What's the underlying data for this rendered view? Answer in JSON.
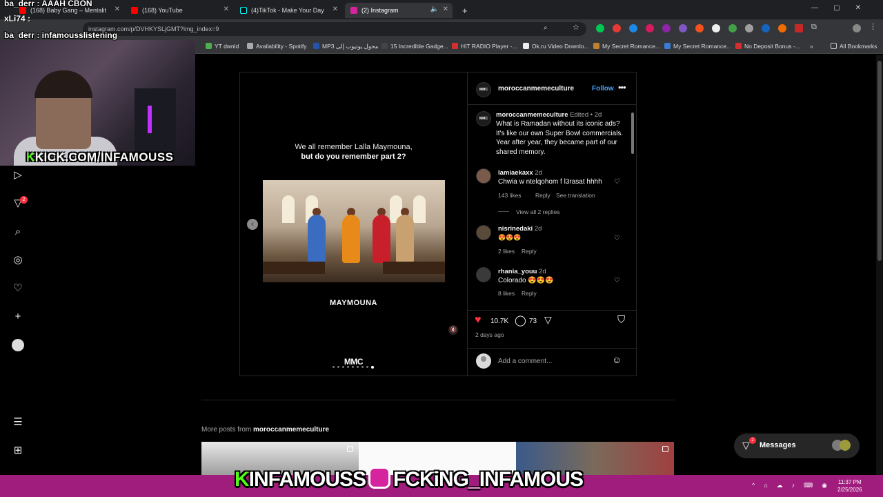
{
  "browser": {
    "tabs": [
      {
        "label": "(168) Baby Gang – Mentalit",
        "color": "#ff0000",
        "active": false
      },
      {
        "label": "(168) YouTube",
        "color": "#ff0000",
        "active": false
      },
      {
        "label": "(4)TikTok - Make Your Day",
        "color": "#111111",
        "active": false
      },
      {
        "label": "(2) Instagram",
        "color": "#d6249f",
        "active": true
      }
    ],
    "new_tab": "+",
    "url": "instagram.com/p/DVHKYSLjGMT?img_index=9",
    "bookmarks": [
      {
        "label": "YT dwnld",
        "color": "#4caf50"
      },
      {
        "label": "Availability - Spotify",
        "color": "#aaaaaa"
      },
      {
        "label": "MP3 محول يوتيوب إلى",
        "color": "#2255aa"
      },
      {
        "label": "15 Incredible Gadge...",
        "color": "#444444"
      },
      {
        "label": "HIT RADIO Player -...",
        "color": "#d32f2f"
      },
      {
        "label": "Ok.ru Video Downlo...",
        "color": "#eeeeee"
      },
      {
        "label": "My Secret Romance...",
        "color": "#c08030"
      },
      {
        "label": "My Secret Romance...",
        "color": "#3a7bd5"
      },
      {
        "label": "No Deposit Bonus -...",
        "color": "#d32f2f"
      }
    ],
    "bookmarks_more": "»",
    "all_bookmarks": "All Bookmarks"
  },
  "stream": {
    "chat_line1": "ba_derr : AAAH CBON",
    "chat_user": "xLi74 :",
    "chat_line2": "ba_derr : infamousslistening",
    "kick_k": "K",
    "kick_text": "KICK.COM/INFAMOUSS",
    "banner_k": "K",
    "banner_name": "INFAMOUSS",
    "banner_handle": "FCKiNG_INFAMOUS"
  },
  "sidebar": {
    "notif_count": "2"
  },
  "post": {
    "username": "moroccanmemeculture",
    "follow": "Follow",
    "more": "•••",
    "avatar_text": "MMC",
    "media": {
      "caption_line1": "We all remember Lalla Maymouna,",
      "caption_line2": "but do you remember part 2?",
      "movie_title": "MAYMOUNA",
      "logo": "MMC",
      "prev": "‹",
      "mute": "🔇",
      "slide_count": 9,
      "active_slide": 9
    },
    "description": {
      "username": "moroccanmemeculture",
      "meta": "Edited • 2d",
      "text": "What is Ramadan without its iconic ads? It's like our own Super Bowl commercials. Year after year, they became part of our shared memory."
    },
    "comments": [
      {
        "username": "lamiaekaxx",
        "age": "2d",
        "text": "Chwia w ntelqohom f l3rasat hhhh",
        "likes": "143 likes",
        "reply": "Reply",
        "translate": "See translation",
        "avatar": "#7a5a4a"
      },
      {
        "username": "nisrinedaki",
        "age": "2d",
        "text": "😍😍😍",
        "likes": "2 likes",
        "reply": "Reply",
        "avatar": "#5a4a3a"
      },
      {
        "username": "rhania_youu",
        "age": "2d",
        "text": "Colorado 😍😍😍",
        "likes": "8 likes",
        "reply": "Reply",
        "avatar": "#3a3a3a"
      }
    ],
    "view_replies": "View all 2 replies",
    "like_count": "10.7K",
    "comment_count": "73",
    "time_ago": "2 days ago",
    "add_comment_placeholder": "Add a comment..."
  },
  "more_posts": {
    "label": "More posts from",
    "username": "moroccanmemeculture"
  },
  "messages": {
    "label": "Messages",
    "badge": "2"
  },
  "taskbar": {
    "time": "11:37 PM",
    "date": "2/25/2026"
  }
}
